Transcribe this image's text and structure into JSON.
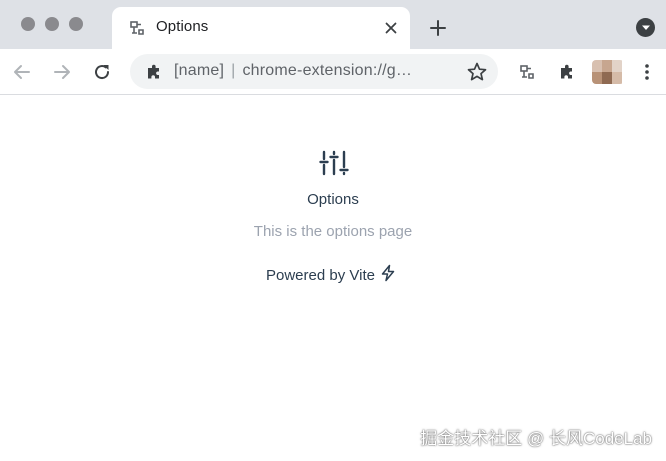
{
  "window": {
    "traffic_lights": [
      "close",
      "minimize",
      "zoom"
    ]
  },
  "tab": {
    "title": "Options",
    "favicon": "extension-plug-icon",
    "close_icon": "close-icon"
  },
  "tabstrip": {
    "new_tab_icon": "plus-icon",
    "menu_icon": "chevron-down-icon"
  },
  "toolbar": {
    "back_icon": "arrow-left-icon",
    "forward_icon": "arrow-right-icon",
    "reload_icon": "reload-icon",
    "omnibox": {
      "site_icon": "puzzle-icon",
      "name": "[name]",
      "separator": "|",
      "url": "chrome-extension://g…",
      "star_icon": "star-icon"
    },
    "extension_icon": "extension-plug-icon",
    "extensions_menu_icon": "puzzle-icon",
    "more_icon": "more-vertical-icon"
  },
  "page": {
    "icon": "sliders-icon",
    "title": "Options",
    "description": "This is the options page",
    "powered_by": "Powered by Vite",
    "powered_icon": "lightning-icon"
  },
  "watermark": "掘金技术社区 @ 长风CodeLab",
  "colors": {
    "tabstrip_bg": "#dee1e6",
    "omnibox_bg": "#f1f3f4",
    "title_text": "#2c3e50",
    "desc_text": "#9ca3af"
  }
}
